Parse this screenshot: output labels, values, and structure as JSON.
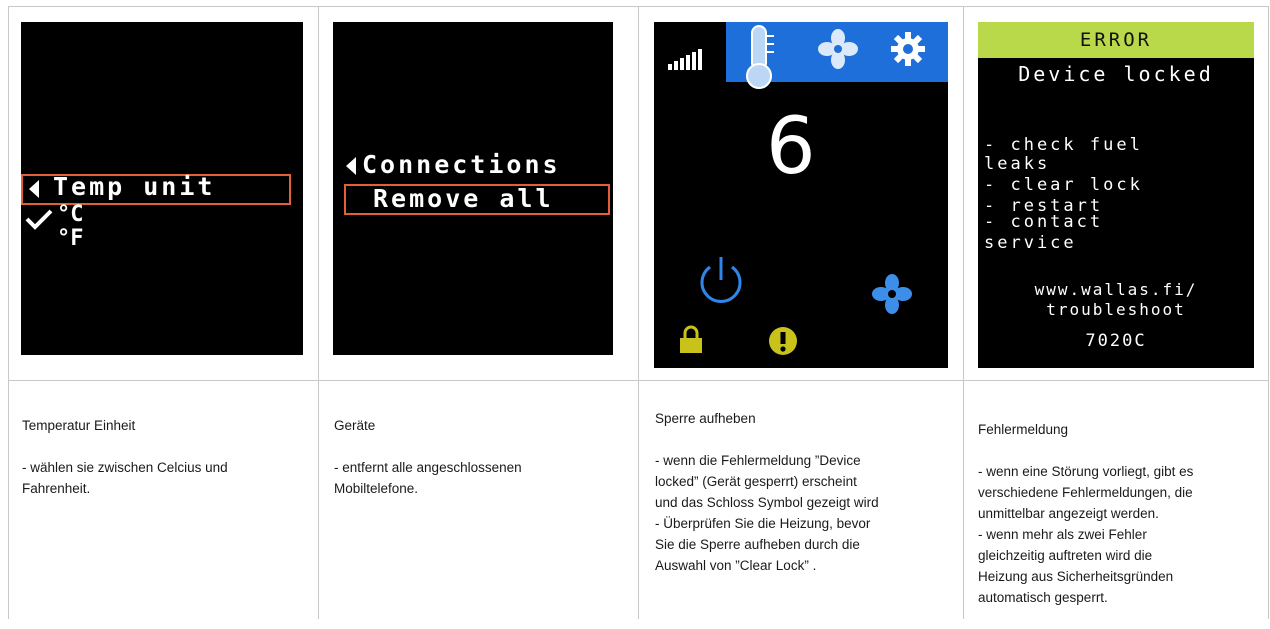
{
  "screens": {
    "temp": {
      "menu_title": "Temp unit",
      "option_c": "°C",
      "option_f": "°F"
    },
    "devices": {
      "menu_title": "Connections",
      "option_remove": "Remove all"
    },
    "main": {
      "value": "6",
      "tab_icons": [
        "signal-strength-icon",
        "thermometer-icon",
        "fan-icon",
        "gear-icon"
      ],
      "bottom_icons": [
        "power-icon",
        "fan-icon",
        "lock-icon",
        "warning-icon"
      ]
    },
    "error": {
      "header": "ERROR",
      "subtitle": "Device locked",
      "line1": "- check fuel",
      "line2": "leaks",
      "line3": "- clear lock",
      "line4": "- restart",
      "line5": "- contact",
      "line6": "service",
      "url1": "www.wallas.fi/",
      "url2": "troubleshoot",
      "code": "7020C"
    }
  },
  "captions": {
    "temp": {
      "title": "Temperatur Einheit",
      "body": "- wählen sie zwischen Celcius und\nFahrenheit."
    },
    "devices": {
      "title": "Geräte",
      "body": "- entfernt alle angeschlossenen\nMobiltelefone."
    },
    "unlock": {
      "title": "Sperre aufheben",
      "body": "- wenn die Fehlermeldung ”Device\nlocked” (Gerät gesperrt) erscheint\nund das Schloss Symbol gezeigt wird\n- Überprüfen Sie die Heizung, bevor\nSie die Sperre aufheben durch die\nAuswahl von ”Clear Lock” ."
    },
    "errors": {
      "title": "Fehlermeldung",
      "body": "- wenn eine Störung vorliegt, gibt es\nverschiedene Fehlermeldungen, die\nunmittelbar angezeigt werden.\n- wenn mehr als zwei Fehler\ngleichzeitig auftreten wird die\nHeizung aus Sicherheitsgründen\nautomatisch gesperrt."
    }
  },
  "colors": {
    "highlight_border": "#e0603a",
    "tab_blue": "#1e6fd9",
    "icon_blue": "#3d8ee8",
    "error_header": "#b9d84a",
    "lock_yellow": "#c9c21a"
  }
}
